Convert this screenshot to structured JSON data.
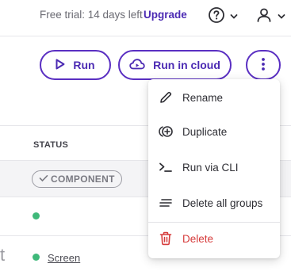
{
  "topbar": {
    "trial_text": "Free trial: 14 days left",
    "upgrade_label": "Upgrade",
    "help_icon": "help-circle-icon",
    "user_icon": "user-icon"
  },
  "toolbar": {
    "run_label": "Run",
    "run_in_cloud_label": "Run in cloud",
    "more_icon": "vertical-dots-icon"
  },
  "table": {
    "status_header": "STATUS",
    "badge_label": "COMPONENT",
    "screen_link": "Screen",
    "clipped_text": "t"
  },
  "menu": {
    "items": [
      {
        "label": "Rename",
        "icon": "pencil-icon"
      },
      {
        "label": "Duplicate",
        "icon": "duplicate-icon"
      },
      {
        "label": "Run via CLI",
        "icon": "terminal-icon"
      },
      {
        "label": "Delete all groups",
        "icon": "lines-icon"
      },
      {
        "label": "Delete",
        "icon": "trash-icon"
      }
    ]
  },
  "colors": {
    "accent": "#5a2fc2",
    "danger": "#d63b3b",
    "status_ok": "#3fb97a"
  }
}
